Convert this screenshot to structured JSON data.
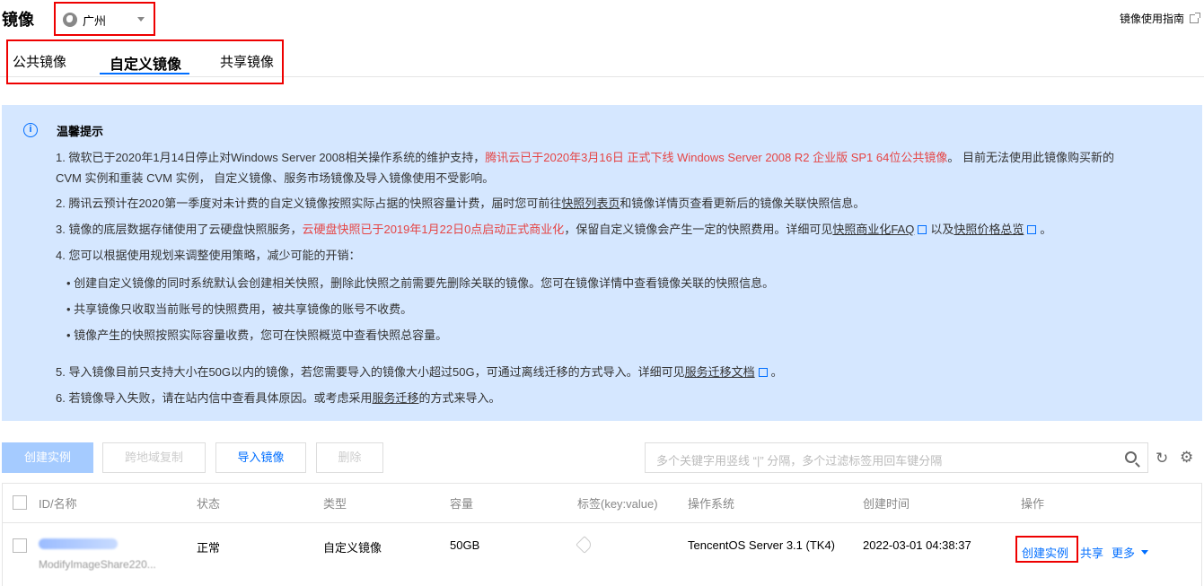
{
  "header": {
    "title": "镜像",
    "region": "广州",
    "guide_label": "镜像使用指南"
  },
  "tabs": [
    {
      "label": "公共镜像"
    },
    {
      "label": "自定义镜像"
    },
    {
      "label": "共享镜像"
    }
  ],
  "notice": {
    "title": "温馨提示",
    "l1a": "1. 微软已于2020年1月14日停止对Windows Server 2008相关操作系统的维护支持，",
    "l1b": "腾讯云已于2020年3月16日 正式下线 Windows Server 2008 R2 企业版 SP1 64位公共镜像",
    "l1c": "。 目前无法使用此镜像购买新的",
    "l1d": "CVM 实例和重装 CVM 实例， 自定义镜像、服务市场镜像及导入镜像使用不受影响。",
    "l2a": "2. 腾讯云预计在2020第一季度对未计费的自定义镜像按照实际占据的快照容量计费，届时您可前往",
    "l2b": "快照列表页",
    "l2c": "和镜像详情页查看更新后的镜像关联快照信息。",
    "l3a": "3. 镜像的底层数据存储使用了云硬盘快照服务，",
    "l3b": "云硬盘快照已于2019年1月22日0点启动正式商业化",
    "l3c": "，保留自定义镜像会产生一定的快照费用。详细可见",
    "l3d": "快照商业化FAQ",
    "l3e": "以及",
    "l3f": "快照价格总览",
    "l3g": "。",
    "l4": "4. 您可以根据使用规划来调整使用策略，减少可能的开销：",
    "b1": "• 创建自定义镜像的同时系统默认会创建相关快照，删除此快照之前需要先删除关联的镜像。您可在镜像详情中查看镜像关联的快照信息。",
    "b2": "• 共享镜像只收取当前账号的快照费用，被共享镜像的账号不收费。",
    "b3": "• 镜像产生的快照按照实际容量收费，您可在快照概览中查看快照总容量。",
    "l5a": "5. 导入镜像目前只支持大小在50G以内的镜像，若您需要导入的镜像大小超过50G，可通过离线迁移的方式导入。详细可见",
    "l5b": "服务迁移文档",
    "l5c": "。",
    "l6a": "6. 若镜像导入失败，请在站内信中查看具体原因。或考虑采用",
    "l6b": "服务迁移",
    "l6c": "的方式来导入。"
  },
  "toolbar": {
    "create": "创建实例",
    "copy": "跨地域复制",
    "import": "导入镜像",
    "delete": "删除",
    "search_placeholder": "多个关键字用竖线 “|” 分隔，多个过滤标签用回车键分隔"
  },
  "table": {
    "headers": [
      "ID/名称",
      "状态",
      "类型",
      "容量",
      "标签(key:value)",
      "操作系统",
      "创建时间",
      "操作"
    ],
    "rows": [
      {
        "name": "ModifyImageShare220...",
        "status": "正常",
        "type": "自定义镜像",
        "capacity": "50GB",
        "os": "TencentOS Server 3.1 (TK4)",
        "created": "2022-03-01 04:38:37",
        "actions": [
          "创建实例",
          "共享",
          "更多"
        ]
      }
    ]
  }
}
